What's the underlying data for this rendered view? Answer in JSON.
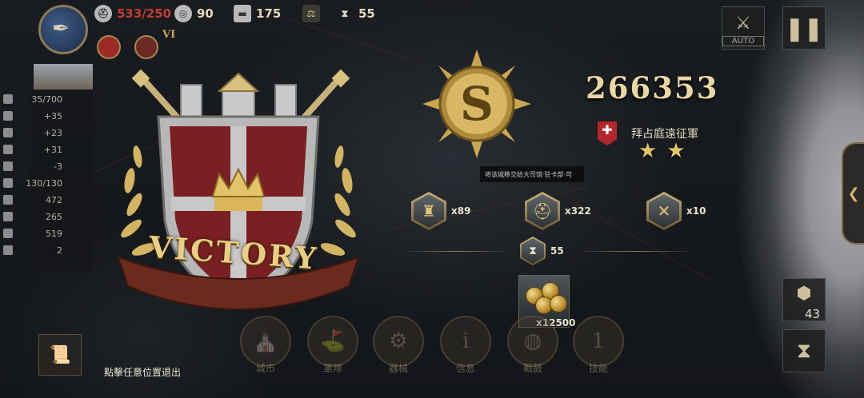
{
  "top_bar": {
    "troops": "533/250",
    "silver": "90",
    "iron": "175",
    "turns": "55",
    "rank": "VI"
  },
  "stat_panel": {
    "rows": [
      "35/700",
      "+35",
      "+23",
      "+31",
      "-3",
      "130/130",
      "472",
      "265",
      "519",
      "2"
    ]
  },
  "victory": {
    "banner_text": "VICTORY"
  },
  "result": {
    "score": "266353",
    "faction_name": "拜占庭遠征軍",
    "stars": 2,
    "tooltip": "将该城移交给大司馆·驻卡部·可"
  },
  "rewards": {
    "items": [
      {
        "icon": "city-icon",
        "qty": "x89"
      },
      {
        "icon": "helmet-icon",
        "qty": "x322"
      },
      {
        "icon": "crossed-arrows-icon",
        "qty": "x10"
      }
    ],
    "turn_bonus": "55",
    "coins_qty": "x12500"
  },
  "bottom_menu": {
    "items": [
      "城市",
      "軍隊",
      "器械",
      "信息",
      "戰鼓",
      "技能"
    ],
    "exit_hint": "點擊任意位置退出"
  },
  "controls": {
    "auto_label": "AUTO",
    "hex_count": "43"
  },
  "colors": {
    "gold": "#e9d8a6",
    "shield_red": "#7a1f22",
    "faction_red": "#b3262a",
    "troop_red": "#c83a34"
  }
}
